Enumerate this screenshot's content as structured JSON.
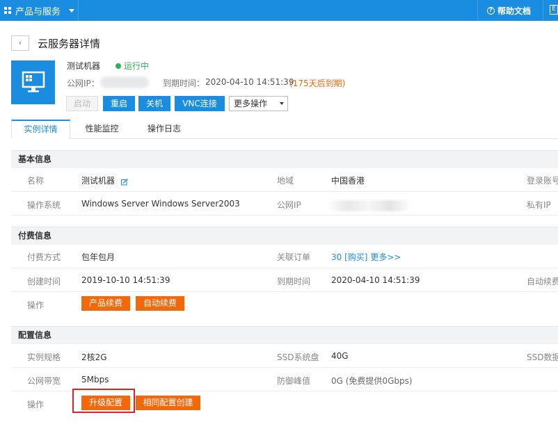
{
  "topbar": {
    "products_label": "产品与服务",
    "help_label": "帮助文档"
  },
  "page": {
    "back_icon": "chevron-left-icon",
    "title": "云服务器详情"
  },
  "server": {
    "name": "测试机器",
    "status": "运行中",
    "status_color": "#2fb356",
    "ip_label": "公网IP：",
    "expire_label": "到期时间：",
    "expire_value": "2020-04-10 14:51:39",
    "expire_remain": "(175天后到期)"
  },
  "actions": {
    "start": "启动",
    "restart": "重启",
    "shutdown": "关机",
    "vnc": "VNC连接",
    "more": "更多操作"
  },
  "tabs": [
    "实例详情",
    "性能监控",
    "操作日志"
  ],
  "basic": {
    "header": "基本信息",
    "name_label": "名称",
    "name_value": "测试机器",
    "region_label": "地域",
    "region_value": "中国香港",
    "login_label": "登录账号",
    "os_label": "操作系统",
    "os_value": "Windows Server Windows Server2003",
    "public_ip_label": "公网IP",
    "private_label": "私有IP"
  },
  "billing": {
    "header": "付费信息",
    "mode_label": "付费方式",
    "mode_value": "包年包月",
    "order_label": "关联订单",
    "order_value": "30",
    "order_buy": "[购买]",
    "order_more": "更多>>",
    "created_label": "创建时间",
    "created_value": "2019-10-10 14:51:39",
    "expire_label": "到期时间",
    "expire_value": "2020-04-10 14:51:39",
    "auto_renew_label": "自动续费",
    "ops_label": "操作",
    "renew_btn": "产品续费",
    "auto_renew_btn": "自动续费"
  },
  "config": {
    "header": "配置信息",
    "spec_label": "实例规格",
    "spec_value": "2核2G",
    "ssd_label": "SSD系统盘",
    "ssd_value": "40G",
    "ssd_data_label": "SSD数据盘",
    "bandwidth_label": "公网带宽",
    "bandwidth_value": "5Mbps",
    "ddos_label": "防御峰值",
    "ddos_value": "0G (免费提供0Gbps)",
    "ops_label": "操作",
    "upgrade_btn": "升级配置",
    "clone_btn": "相同配置创建"
  },
  "colors": {
    "brand_blue": "#1a8de0",
    "orange": "#f2680b",
    "highlight_red": "#e02020"
  }
}
